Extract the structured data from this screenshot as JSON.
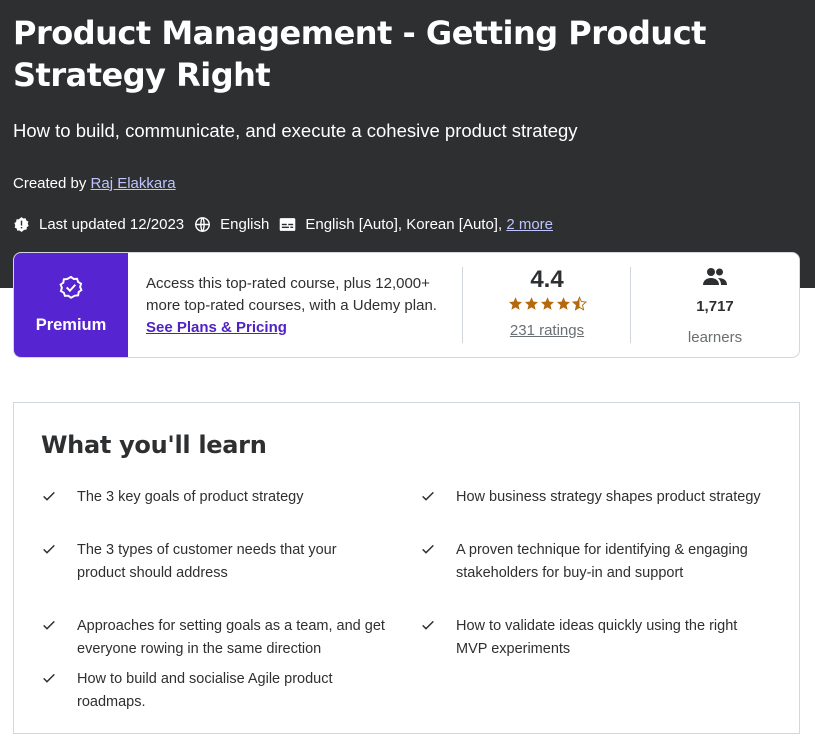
{
  "course": {
    "title": "Product Management - Getting Product Strategy Right",
    "subtitle": "How to build, communicate, and execute a cohesive product strategy",
    "created_by_label": "Created by",
    "instructor": "Raj Elakkara",
    "last_updated": "Last updated 12/2023",
    "language": "English",
    "captions": "English [Auto], Korean [Auto],",
    "captions_more": "2 more"
  },
  "premium": {
    "label": "Premium",
    "access_text": "Access this top-rated course, plus 12,000+ more top-rated courses, with a Udemy plan.",
    "plans_link": "See Plans & Pricing"
  },
  "stats": {
    "rating": "4.4",
    "stars_value": 4.4,
    "ratings_count": "231 ratings",
    "learners": "1,717",
    "learners_label": "learners"
  },
  "learn": {
    "heading": "What you'll learn",
    "items": [
      "The 3 key goals of product strategy",
      "How business strategy shapes product strategy",
      "The 3 types of customer needs that your product should address",
      "A proven technique for identifying & engaging stakeholders for buy-in and support",
      "Approaches for setting goals as a team, and get everyone rowing in the same direction",
      "How to validate ideas quickly using the right MVP experiments",
      "How to build and socialise Agile product roadmaps."
    ]
  },
  "colors": {
    "hero_bg": "#2d2f31",
    "premium_bg": "#5624d0",
    "link_purple": "#5022c3",
    "star": "#b4690e"
  }
}
